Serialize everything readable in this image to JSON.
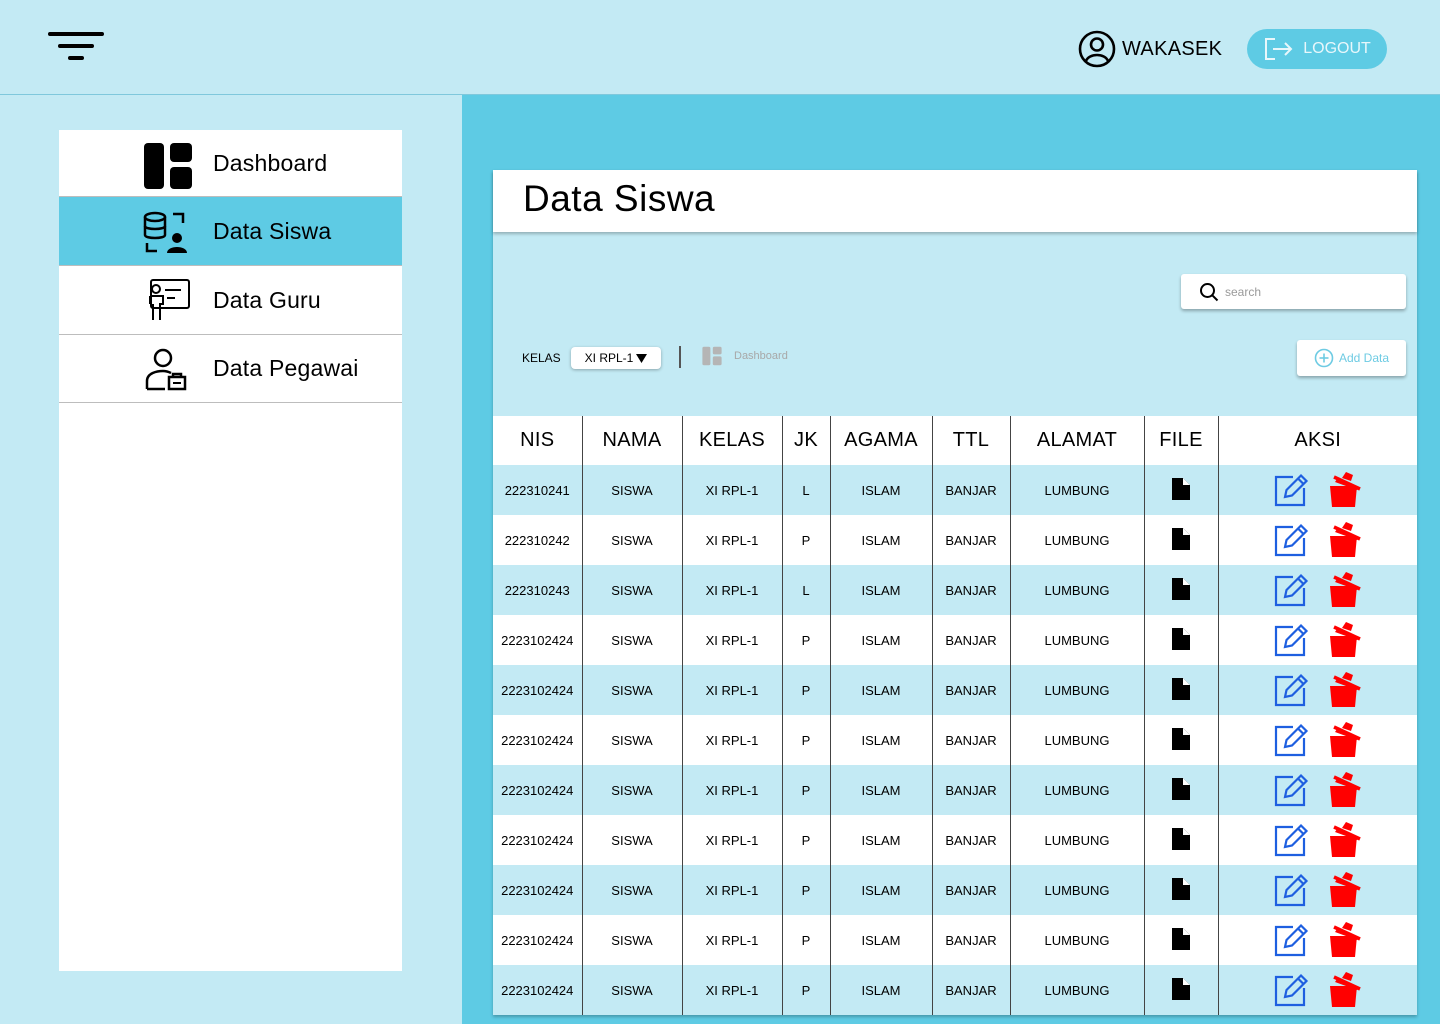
{
  "header": {
    "user_name": "WAKASEK",
    "logout_label": "LOGOUT",
    "icons": {
      "menu": "filter-lines-icon",
      "user": "user-circle-icon",
      "logout": "logout-icon"
    }
  },
  "sidebar": {
    "items": [
      {
        "label": "Dashboard",
        "icon": "dashboard-icon",
        "active": false
      },
      {
        "label": "Data Siswa",
        "icon": "database-user-icon",
        "active": true
      },
      {
        "label": "Data Guru",
        "icon": "teacher-board-icon",
        "active": false
      },
      {
        "label": "Data Pegawai",
        "icon": "employee-icon",
        "active": false
      }
    ]
  },
  "main": {
    "title": "Data Siswa",
    "search_placeholder": "search",
    "kelas_label": "KELAS",
    "kelas_selected": "XI RPL-1",
    "breadcrumb_label": "Dashboard",
    "add_label": "Add Data"
  },
  "table": {
    "columns": [
      "NIS",
      "NAMA",
      "KELAS",
      "JK",
      "AGAMA",
      "TTL",
      "ALAMAT",
      "FILE",
      "AKSI"
    ],
    "rows": [
      {
        "nis": "222310241",
        "nama": "SISWA",
        "kelas": "XI RPL-1",
        "jk": "L",
        "agama": "ISLAM",
        "ttl": "BANJAR",
        "alamat": "LUMBUNG"
      },
      {
        "nis": "222310242",
        "nama": "SISWA",
        "kelas": "XI RPL-1",
        "jk": "P",
        "agama": "ISLAM",
        "ttl": "BANJAR",
        "alamat": "LUMBUNG"
      },
      {
        "nis": "222310243",
        "nama": "SISWA",
        "kelas": "XI RPL-1",
        "jk": "L",
        "agama": "ISLAM",
        "ttl": "BANJAR",
        "alamat": "LUMBUNG"
      },
      {
        "nis": "2223102424",
        "nama": "SISWA",
        "kelas": "XI RPL-1",
        "jk": "P",
        "agama": "ISLAM",
        "ttl": "BANJAR",
        "alamat": "LUMBUNG"
      },
      {
        "nis": "2223102424",
        "nama": "SISWA",
        "kelas": "XI RPL-1",
        "jk": "P",
        "agama": "ISLAM",
        "ttl": "BANJAR",
        "alamat": "LUMBUNG"
      },
      {
        "nis": "2223102424",
        "nama": "SISWA",
        "kelas": "XI RPL-1",
        "jk": "P",
        "agama": "ISLAM",
        "ttl": "BANJAR",
        "alamat": "LUMBUNG"
      },
      {
        "nis": "2223102424",
        "nama": "SISWA",
        "kelas": "XI RPL-1",
        "jk": "P",
        "agama": "ISLAM",
        "ttl": "BANJAR",
        "alamat": "LUMBUNG"
      },
      {
        "nis": "2223102424",
        "nama": "SISWA",
        "kelas": "XI RPL-1",
        "jk": "P",
        "agama": "ISLAM",
        "ttl": "BANJAR",
        "alamat": "LUMBUNG"
      },
      {
        "nis": "2223102424",
        "nama": "SISWA",
        "kelas": "XI RPL-1",
        "jk": "P",
        "agama": "ISLAM",
        "ttl": "BANJAR",
        "alamat": "LUMBUNG"
      },
      {
        "nis": "2223102424",
        "nama": "SISWA",
        "kelas": "XI RPL-1",
        "jk": "P",
        "agama": "ISLAM",
        "ttl": "BANJAR",
        "alamat": "LUMBUNG"
      },
      {
        "nis": "2223102424",
        "nama": "SISWA",
        "kelas": "XI RPL-1",
        "jk": "P",
        "agama": "ISLAM",
        "ttl": "BANJAR",
        "alamat": "LUMBUNG"
      }
    ],
    "row_icons": {
      "file": "file-icon",
      "edit": "edit-icon",
      "delete": "trash-icon"
    }
  },
  "colors": {
    "background_light": "#c3eaf4",
    "accent": "#5ecbe4",
    "edit_blue": "#1e5fe0",
    "delete_red": "#ff0000"
  }
}
